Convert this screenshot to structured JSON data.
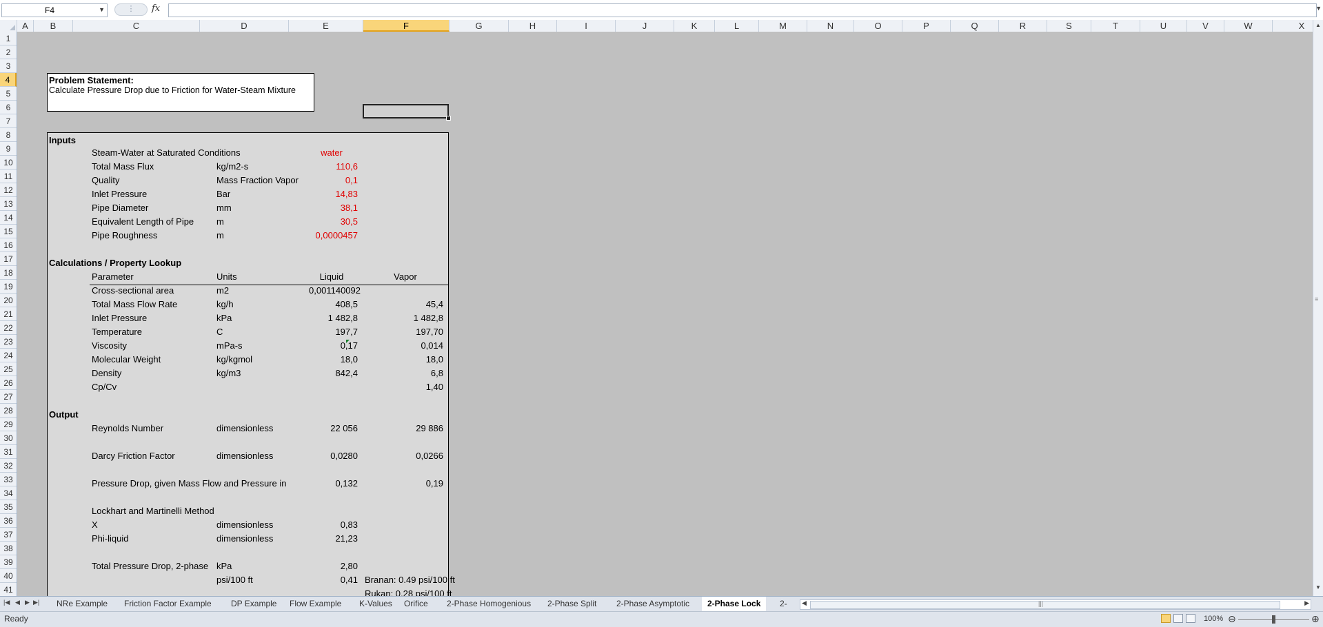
{
  "formula_bar": {
    "name_box": "F4",
    "fx_label": "fx",
    "formula": ""
  },
  "columns": [
    "A",
    "B",
    "C",
    "D",
    "E",
    "F",
    "G",
    "H",
    "I",
    "J",
    "K",
    "L",
    "M",
    "N",
    "O",
    "P",
    "Q",
    "R",
    "S",
    "T",
    "U",
    "V",
    "W",
    "X"
  ],
  "selected_column": "F",
  "rows": [
    "1",
    "2",
    "3",
    "4",
    "5",
    "6",
    "7",
    "8",
    "9",
    "10",
    "11",
    "12",
    "13",
    "14",
    "15",
    "16",
    "17",
    "18",
    "19",
    "20",
    "21",
    "22",
    "23",
    "24",
    "25",
    "26",
    "27",
    "28",
    "29",
    "30",
    "31",
    "32",
    "33",
    "34",
    "35",
    "36",
    "37",
    "38",
    "39",
    "40",
    "41"
  ],
  "selected_row": "4",
  "sheet": {
    "problem_title": "Problem Statement:",
    "problem_text": "Calculate Pressure Drop due to Friction for Water-Steam Mixture",
    "inputs_header": "Inputs",
    "inputs": [
      {
        "label": "Steam-Water at Saturated Conditions",
        "unit": "",
        "value": "water"
      },
      {
        "label": "Total Mass Flux",
        "unit": "kg/m2-s",
        "value": "110,6"
      },
      {
        "label": "Quality",
        "unit": "Mass Fraction Vapor",
        "value": "0,1"
      },
      {
        "label": "Inlet Pressure",
        "unit": "Bar",
        "value": "14,83"
      },
      {
        "label": "Pipe Diameter",
        "unit": "mm",
        "value": "38,1"
      },
      {
        "label": "Equivalent Length of Pipe",
        "unit": "m",
        "value": "30,5"
      },
      {
        "label": "Pipe Roughness",
        "unit": "m",
        "value": "0,0000457"
      }
    ],
    "calc_header": "Calculations / Property Lookup",
    "calc_cols": {
      "param": "Parameter",
      "units": "Units",
      "liquid": "Liquid",
      "vapor": "Vapor"
    },
    "calcs": [
      {
        "param": "Cross-sectional area",
        "units": "m2",
        "liquid": "0,001140092",
        "vapor": ""
      },
      {
        "param": "Total Mass Flow Rate",
        "units": "kg/h",
        "liquid": "408,5",
        "vapor": "45,4"
      },
      {
        "param": "Inlet Pressure",
        "units": "kPa",
        "liquid": "1 482,8",
        "vapor": "1 482,8"
      },
      {
        "param": "Temperature",
        "units": "C",
        "liquid": "197,7",
        "vapor": "197,70"
      },
      {
        "param": "Viscosity",
        "units": "mPa-s",
        "liquid": "0,17",
        "vapor": "0,014"
      },
      {
        "param": "Molecular Weight",
        "units": "kg/kgmol",
        "liquid": "18,0",
        "vapor": "18,0"
      },
      {
        "param": "Density",
        "units": "kg/m3",
        "liquid": "842,4",
        "vapor": "6,8"
      },
      {
        "param": "Cp/Cv",
        "units": "",
        "liquid": "",
        "vapor": "1,40"
      }
    ],
    "output_header": "Output",
    "outputs": {
      "reynolds": {
        "label": "Reynolds Number",
        "units": "dimensionless",
        "liquid": "22 056",
        "vapor": "29 886"
      },
      "darcy": {
        "label": "Darcy Friction Factor",
        "units": "dimensionless",
        "liquid": "0,0280",
        "vapor": "0,0266"
      },
      "dp": {
        "label": "Pressure Drop, given Mass Flow and Pressure in",
        "liquid": "0,132",
        "vapor": "0,19"
      },
      "lm_title": "Lockhart and Martinelli Method",
      "x": {
        "label": "X",
        "units": "dimensionless",
        "liquid": "0,83"
      },
      "phi": {
        "label": "Phi-liquid",
        "units": "dimensionless",
        "liquid": "21,23"
      },
      "total": {
        "label": "Total Pressure Drop, 2-phase",
        "units": "kPa",
        "liquid": "2,80"
      },
      "total_psi": {
        "units": "psi/100 ft",
        "liquid": "0,41"
      },
      "branan": "Branan: 0.49 psi/100 ft",
      "rukan": "Rukan: 0.28 psi/100 ft"
    }
  },
  "tabs": [
    "NRe Example",
    "Friction Factor Example",
    "DP Example",
    "Flow Example",
    "K-Values",
    "Orifice",
    "2-Phase Homogenious",
    "2-Phase Split",
    "2-Phase Asymptotic",
    "2-Phase Lock",
    "2-"
  ],
  "active_tab": "2-Phase Lock",
  "status": {
    "ready": "Ready",
    "zoom": "100%"
  },
  "colors": {
    "input_red": "#e00000",
    "selection_gold": "#f9d57a",
    "sheet_gray": "#c0c0c0",
    "table_fill": "#d9d9d9"
  }
}
